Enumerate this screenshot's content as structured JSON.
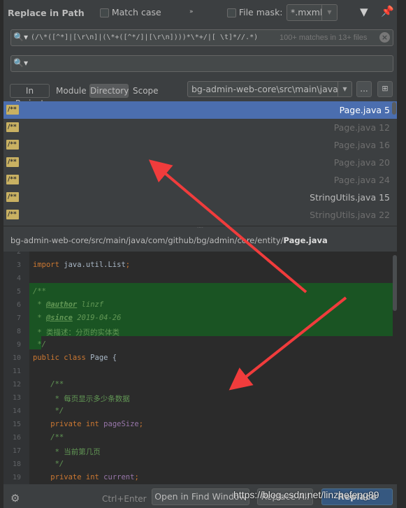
{
  "header": {
    "title": "Replace in Path",
    "match_case": "Match case",
    "more": "»",
    "file_mask_label": "File mask:",
    "file_mask_value": "*.mxml"
  },
  "search": {
    "query": "(/\\*([^*]|[\\r\\n]|(\\*+([^*/]|[\\r\\n])))*\\*+/|[ \\t]*//.*)",
    "status": "100+ matches in 13+ files",
    "replace_value": ""
  },
  "scope": {
    "tabs": [
      "In Project",
      "Module",
      "Directory",
      "Scope"
    ],
    "active": "Directory",
    "directory": "bg-admin-web-core\\src\\main\\java",
    "browse": "..."
  },
  "results": [
    {
      "icon": "/**",
      "file": "Page.java 5",
      "selected": true
    },
    {
      "icon": "/**",
      "file": "Page.java 12",
      "dim": true
    },
    {
      "icon": "/**",
      "file": "Page.java 16",
      "dim": true
    },
    {
      "icon": "/**",
      "file": "Page.java 20",
      "dim": true
    },
    {
      "icon": "/**",
      "file": "Page.java 24",
      "dim": true
    },
    {
      "icon": "/**",
      "file": "StringUtils.java 15"
    },
    {
      "icon": "/**",
      "file": "StringUtils.java 22",
      "dim": true
    }
  ],
  "preview": {
    "path_prefix": "bg-admin-web-core/src/main/java/com/github/bg/admin/core/entity/",
    "path_file": "Page.java",
    "lines": [
      {
        "n": "2",
        "html": ""
      },
      {
        "n": "3",
        "html": "<span class='kw'>import</span> java.util.List<span class='kw'>;</span>"
      },
      {
        "n": "4",
        "html": ""
      },
      {
        "n": "5",
        "html": "<span class='cm'><i>/**</i></span>"
      },
      {
        "n": "6",
        "html": "<span class='cm'><i> * </i></span><span class='tag'><i>@author</i></span><span class='cm'><i> linzf</i></span>"
      },
      {
        "n": "7",
        "html": "<span class='cm'><i> * </i></span><span class='tag'><i>@since</i></span><span class='cm'><i> 2019-04-26</i></span>"
      },
      {
        "n": "8",
        "html": "<span class='cm'> * 类描述：分页的实体类</span>"
      },
      {
        "n": "9",
        "html": "<span class='cm'><i> */</i></span>"
      },
      {
        "n": "10",
        "html": "<span class='kw'>public class</span> Page {"
      },
      {
        "n": "11",
        "html": ""
      },
      {
        "n": "12",
        "html": "<span class='cm'><i>    /**</i></span>"
      },
      {
        "n": "13",
        "html": "<span class='cm'>     * 每页显示多少条数据</span>"
      },
      {
        "n": "14",
        "html": "<span class='cm'><i>     */</i></span>"
      },
      {
        "n": "15",
        "html": "    <span class='kw'>private int</span> <span class='fld'>pageSize</span><span class='kw'>;</span>"
      },
      {
        "n": "16",
        "html": "<span class='cm'><i>    /**</i></span>"
      },
      {
        "n": "17",
        "html": "<span class='cm'>     * 当前第几页</span>"
      },
      {
        "n": "18",
        "html": "<span class='cm'><i>     */</i></span>"
      },
      {
        "n": "19",
        "html": "    <span class='kw'>private int</span> <span class='fld'>current</span><span class='kw'>;</span>"
      }
    ]
  },
  "footer": {
    "shortcut": "Ctrl+Enter",
    "open_in_find": "Open in Find Window",
    "replace_all": "Replace All",
    "replace": "Replace"
  },
  "watermark": "https://blog.csdn.net/linzhefeng89",
  "colors": {
    "selection": "#4b6eaf",
    "highlight": "#1a5423",
    "arrow": "#f03c3c"
  }
}
